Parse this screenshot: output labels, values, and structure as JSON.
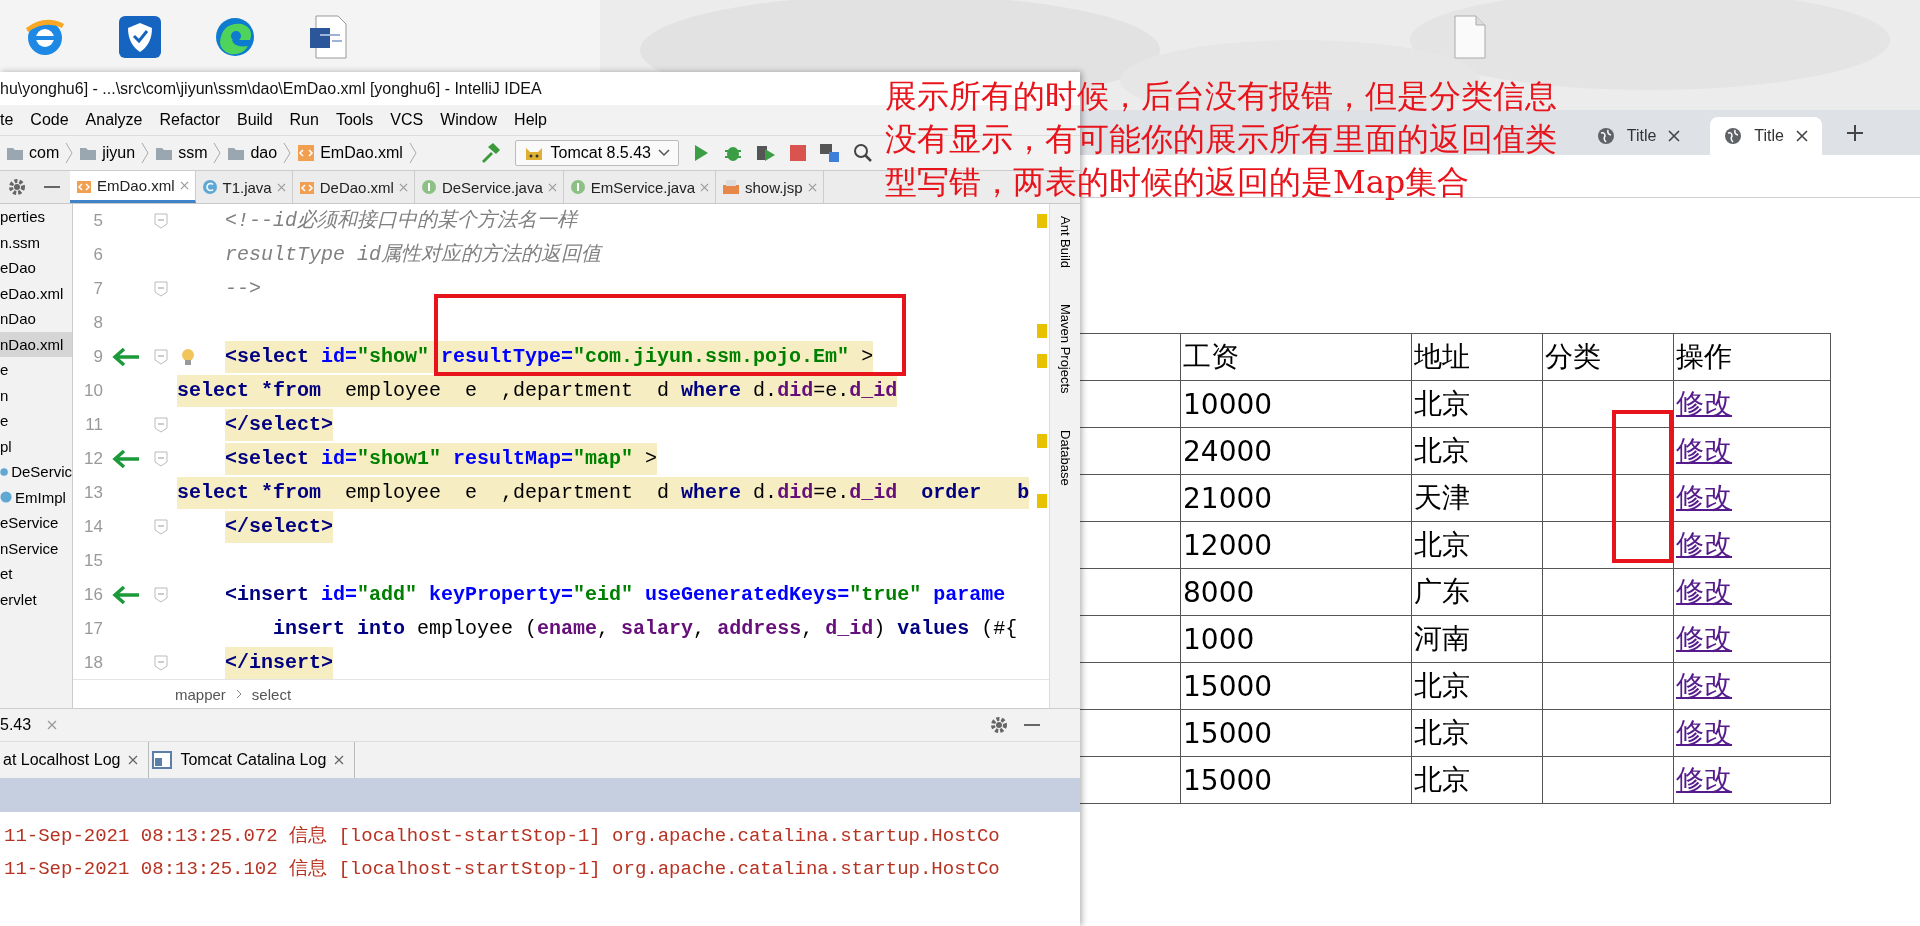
{
  "desktop": {
    "icons": [
      {
        "kind": "ie"
      },
      {
        "kind": "shield"
      },
      {
        "kind": "edge"
      },
      {
        "kind": "word"
      },
      {
        "kind": "file"
      }
    ]
  },
  "ide": {
    "title": "hu\\yonghu6] - ...\\src\\com\\jiyun\\ssm\\dao\\EmDao.xml [yonghu6] - IntelliJ IDEA",
    "menu": [
      "te",
      "Code",
      "Analyze",
      "Refactor",
      "Build",
      "Run",
      "Tools",
      "VCS",
      "Window",
      "Help"
    ],
    "breadcrumb": [
      "com",
      "jiyun",
      "ssm",
      "dao",
      "EmDao.xml"
    ],
    "run_config": "Tomcat 8.5.43",
    "tabs": [
      {
        "label": "EmDao.xml",
        "kind": "xml",
        "selected": true
      },
      {
        "label": "T1.java",
        "kind": "class",
        "selected": false
      },
      {
        "label": "DeDao.xml",
        "kind": "xml",
        "selected": false
      },
      {
        "label": "DeService.java",
        "kind": "interface",
        "selected": false
      },
      {
        "label": "EmService.java",
        "kind": "interface",
        "selected": false
      },
      {
        "label": "show.jsp",
        "kind": "jsp",
        "selected": false
      }
    ],
    "project_items": [
      {
        "label": "perties",
        "kind": "plain",
        "selected": false
      },
      {
        "label": "n.ssm",
        "kind": "plain",
        "selected": false
      },
      {
        "label": "eDao",
        "kind": "plain",
        "selected": false
      },
      {
        "label": "eDao.xml",
        "kind": "plain",
        "selected": false
      },
      {
        "label": "nDao",
        "kind": "plain",
        "selected": false
      },
      {
        "label": "nDao.xml",
        "kind": "plain",
        "selected": true
      },
      {
        "label": "e",
        "kind": "plain",
        "selected": false
      },
      {
        "label": "n",
        "kind": "plain",
        "selected": false
      },
      {
        "label": "e",
        "kind": "plain",
        "selected": false
      },
      {
        "label": "pl",
        "kind": "plain",
        "selected": false
      },
      {
        "label": "DeServic",
        "kind": "class",
        "selected": false
      },
      {
        "label": "EmImpl",
        "kind": "class",
        "selected": false
      },
      {
        "label": "eService",
        "kind": "plain",
        "selected": false
      },
      {
        "label": "nService",
        "kind": "plain",
        "selected": false
      },
      {
        "label": "et",
        "kind": "plain",
        "selected": false
      },
      {
        "label": "ervlet",
        "kind": "plain",
        "selected": false
      }
    ],
    "code_lines": [
      {
        "number": "5",
        "kind": "inner",
        "arrow": false,
        "bulb": false,
        "fold": true,
        "highlighted": false,
        "segments": [
          {
            "kind": "comment",
            "text": "<!--id必须和接口中的某个方法名一样"
          }
        ]
      },
      {
        "number": "6",
        "kind": "inner",
        "arrow": false,
        "bulb": false,
        "fold": false,
        "highlighted": false,
        "segments": [
          {
            "kind": "comment",
            "text": "resultType id属性对应的方法的返回值"
          }
        ]
      },
      {
        "number": "7",
        "kind": "inner",
        "arrow": false,
        "bulb": false,
        "fold": true,
        "highlighted": false,
        "segments": [
          {
            "kind": "comment",
            "text": "-->"
          }
        ]
      },
      {
        "number": "8",
        "kind": "inner",
        "arrow": false,
        "bulb": false,
        "fold": false
      },
      {
        "number": "9",
        "kind": "inner",
        "arrow": true,
        "bulb": true,
        "fold": true,
        "highlighted": true,
        "segments": [
          {
            "kind": "tag",
            "text": "<select"
          },
          {
            "kind": "attr",
            "text": " id="
          },
          {
            "kind": "value",
            "text": "\"show\""
          },
          {
            "kind": "attr",
            "text": " resultType="
          },
          {
            "kind": "value",
            "text": "\"com.jiyun.ssm.pojo.Em\""
          },
          {
            "kind": "plain",
            "text": " >"
          }
        ]
      },
      {
        "number": "10",
        "kind": "top",
        "arrow": false,
        "bulb": false,
        "fold": false,
        "highlighted": true,
        "segments": [
          {
            "kind": "keyword",
            "text": "select *from"
          },
          {
            "kind": "plain",
            "text": "  employee  e  ,department  d"
          },
          {
            "kind": "keyword",
            "text": " where"
          },
          {
            "kind": "plain",
            "text": " d."
          },
          {
            "kind": "field",
            "text": "did"
          },
          {
            "kind": "plain",
            "text": "=e."
          },
          {
            "kind": "field",
            "text": "d_id"
          }
        ]
      },
      {
        "number": "11",
        "kind": "inner",
        "arrow": false,
        "bulb": false,
        "fold": true,
        "highlighted": true,
        "segments": [
          {
            "kind": "tag",
            "text": "</select>"
          }
        ]
      },
      {
        "number": "12",
        "kind": "inner",
        "arrow": true,
        "bulb": false,
        "fold": true,
        "highlighted": true,
        "segments": [
          {
            "kind": "tag",
            "text": "<select"
          },
          {
            "kind": "attr",
            "text": " id="
          },
          {
            "kind": "value",
            "text": "\"show1\""
          },
          {
            "kind": "attr",
            "text": " resultMap="
          },
          {
            "kind": "value",
            "text": "\"map\""
          },
          {
            "kind": "plain",
            "text": " >"
          }
        ]
      },
      {
        "number": "13",
        "kind": "top",
        "arrow": false,
        "bulb": false,
        "fold": false,
        "highlighted": true,
        "segments": [
          {
            "kind": "keyword",
            "text": "select *from"
          },
          {
            "kind": "plain",
            "text": "  employee  e  ,department  d"
          },
          {
            "kind": "keyword",
            "text": " where"
          },
          {
            "kind": "plain",
            "text": " d."
          },
          {
            "kind": "field",
            "text": "did"
          },
          {
            "kind": "plain",
            "text": "=e."
          },
          {
            "kind": "field",
            "text": "d_id"
          },
          {
            "kind": "keyword",
            "text": "  order   b"
          }
        ]
      },
      {
        "number": "14",
        "kind": "inner",
        "arrow": false,
        "bulb": false,
        "fold": true,
        "highlighted": true,
        "segments": [
          {
            "kind": "tag",
            "text": "</select>"
          }
        ]
      },
      {
        "number": "15",
        "kind": "inner",
        "arrow": false,
        "bulb": false,
        "fold": false
      },
      {
        "number": "16",
        "kind": "inner",
        "arrow": true,
        "bulb": false,
        "fold": true,
        "highlighted": false,
        "segments": [
          {
            "kind": "tag",
            "text": "<insert"
          },
          {
            "kind": "attr",
            "text": " id="
          },
          {
            "kind": "value",
            "text": "\"add\""
          },
          {
            "kind": "attr",
            "text": " keyProperty="
          },
          {
            "kind": "value",
            "text": "\"eid\""
          },
          {
            "kind": "attr",
            "text": " useGeneratedKeys="
          },
          {
            "kind": "value",
            "text": "\"true\""
          },
          {
            "kind": "attr",
            "text": " parame"
          }
        ]
      },
      {
        "number": "17",
        "kind": "body",
        "arrow": false,
        "bulb": false,
        "fold": false,
        "highlighted": false,
        "segments": [
          {
            "kind": "keyword",
            "text": "insert into"
          },
          {
            "kind": "plain",
            "text": " employee ("
          },
          {
            "kind": "field",
            "text": "ename"
          },
          {
            "kind": "plain",
            "text": ", "
          },
          {
            "kind": "field",
            "text": "salary"
          },
          {
            "kind": "plain",
            "text": ", "
          },
          {
            "kind": "field",
            "text": "address"
          },
          {
            "kind": "plain",
            "text": ", "
          },
          {
            "kind": "field",
            "text": "d_id"
          },
          {
            "kind": "plain",
            "text": ")"
          },
          {
            "kind": "keyword",
            "text": " values"
          },
          {
            "kind": "plain",
            "text": " (#{"
          }
        ]
      },
      {
        "number": "18",
        "kind": "inner",
        "arrow": false,
        "bulb": false,
        "fold": true,
        "highlighted": true,
        "segments": [
          {
            "kind": "tag",
            "text": "</insert>"
          }
        ]
      }
    ],
    "editor_breadcrumb": [
      "mapper",
      "select"
    ],
    "side_tools": [
      "Ant Build",
      "Maven Projects",
      "Database"
    ],
    "run_panel": {
      "title": "5.43",
      "tabs": [
        {
          "label": "at Localhost Log",
          "selected": false
        },
        {
          "label": "Tomcat Catalina Log",
          "selected": false
        }
      ],
      "log_lines": [
        "11-Sep-2021 08:13:25.072 信息 [localhost-startStop-1] org.apache.catalina.startup.HostCo",
        "11-Sep-2021 08:13:25.102 信息 [localhost-startStop-1] org.apache.catalina.startup.HostCo"
      ]
    }
  },
  "browser": {
    "tabs": [
      {
        "label": "Title",
        "selected": false
      },
      {
        "label": "Title",
        "selected": true
      }
    ],
    "table": {
      "columns": [
        "工资",
        "地址",
        "分类",
        "操作"
      ],
      "rows": [
        {
          "salary": "10000",
          "address": "北京",
          "action": "修改"
        },
        {
          "salary": "24000",
          "address": "北京",
          "action": "修改"
        },
        {
          "salary": "21000",
          "address": "天津",
          "action": "修改"
        },
        {
          "salary": "12000",
          "address": "北京",
          "action": "修改"
        },
        {
          "salary": "8000",
          "address": "广东",
          "action": "修改"
        },
        {
          "salary": "1000",
          "address": "河南",
          "action": "修改"
        },
        {
          "salary": "15000",
          "address": "北京",
          "action": "修改"
        },
        {
          "salary": "15000",
          "address": "北京",
          "action": "修改"
        },
        {
          "salary": "15000",
          "address": "北京",
          "action": "修改"
        }
      ]
    }
  },
  "annotation": {
    "lines": [
      "展示所有的时候，后台没有报错，但是分类信息",
      "没有显示，有可能你的展示所有里面的返回值类",
      "型写错，两表的时候的返回的是Map集合"
    ]
  }
}
